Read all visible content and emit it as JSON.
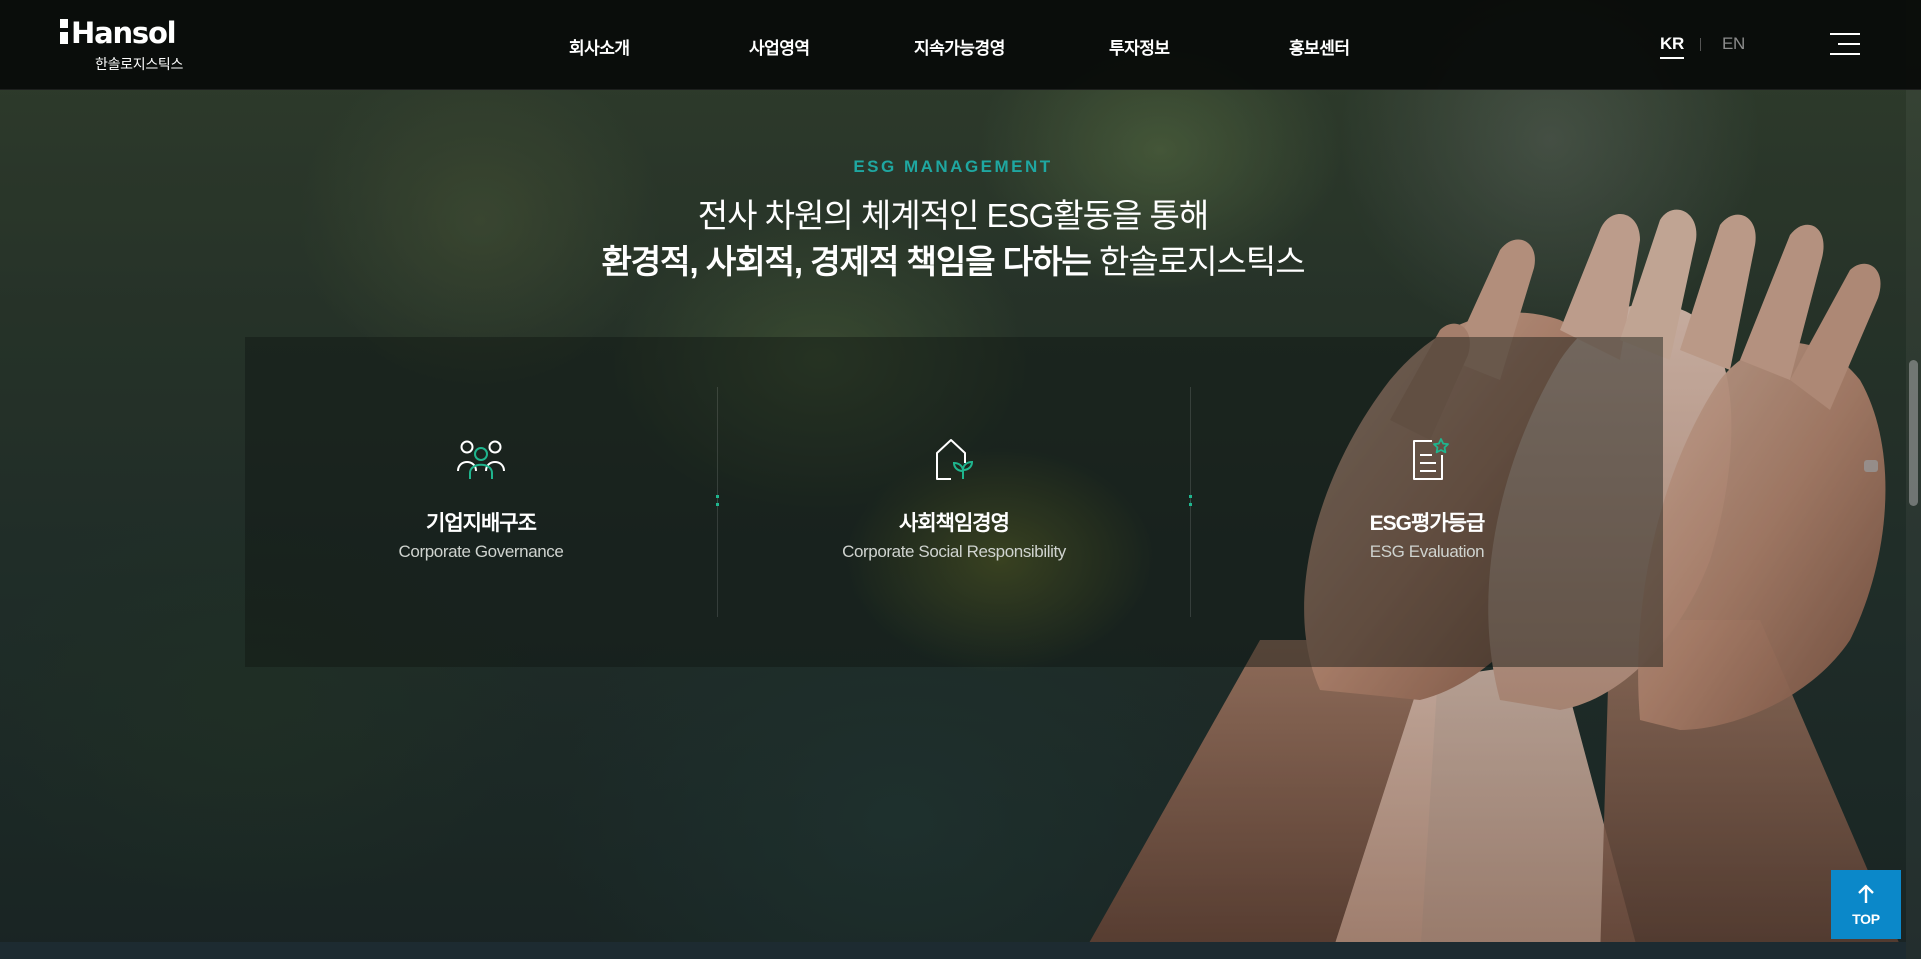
{
  "header": {
    "logo": {
      "name": "Hansol",
      "subname": "한솔로지스틱스"
    },
    "nav": [
      {
        "label": "회사소개"
      },
      {
        "label": "사업영역"
      },
      {
        "label": "지속가능경영"
      },
      {
        "label": "투자정보"
      },
      {
        "label": "홍보센터"
      }
    ],
    "languages": {
      "kr": "KR",
      "en": "EN",
      "active": "KR"
    },
    "menu_icon": "hamburger-menu-icon"
  },
  "section": {
    "eyebrow": "ESG MANAGEMENT",
    "headline_line1": "전사 차원의 체계적인 ESG활동을 통해",
    "headline_line2_bold": "환경적, 사회적, 경제적 책임을 다하는",
    "headline_line2_regular": "한솔로지스틱스",
    "cards": [
      {
        "icon": "people-icon",
        "title": "기업지배구조",
        "subtitle": "Corporate Governance"
      },
      {
        "icon": "house-sprout-icon",
        "title": "사회책임경영",
        "subtitle": "Corporate Social Responsibility"
      },
      {
        "icon": "document-star-icon",
        "title": "ESG평가등급",
        "subtitle": "ESG Evaluation"
      }
    ]
  },
  "top_button": {
    "label": "TOP",
    "icon": "arrow-up-icon"
  },
  "colors": {
    "accent_teal": "#1fa7a1",
    "accent_green": "#1fb58e",
    "top_button": "#0b88c9",
    "header_bg": "#080a09"
  }
}
